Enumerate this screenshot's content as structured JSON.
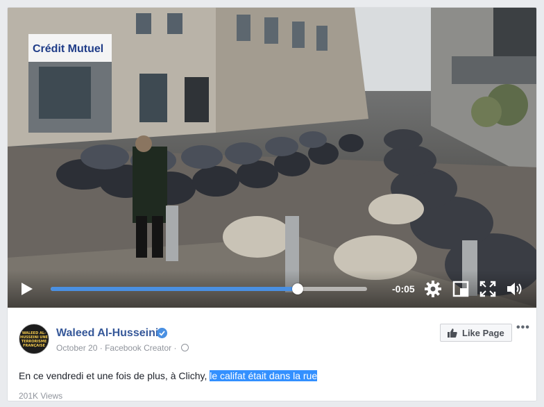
{
  "video": {
    "storefront_sign": "Crédit Mutuel",
    "progress_fraction": 0.78,
    "time_remaining": "-0:05",
    "icons": [
      "play-icon",
      "settings-gear-icon",
      "pip-icon",
      "fullscreen-icon",
      "volume-icon"
    ]
  },
  "post": {
    "page_name": "Waleed Al-Husseini",
    "verified_icon": "verified-badge-icon",
    "date": "October 20",
    "separator": "·",
    "creator_label": "Facebook Creator",
    "privacy_icon": "globe-icon",
    "like_button_label": "Like Page",
    "text_plain": "En ce vendredi et une fois de plus, à Clichy, ",
    "text_highlighted": "le califat était dans la rue",
    "views": "201K Views",
    "avatar_caption": "WALEED AL-HUSSEINI UNE TERRORISME FRANÇAISE"
  },
  "colors": {
    "link": "#365899",
    "progress": "#4a90e2",
    "highlight": "#3390ff",
    "muted": "#90949c"
  }
}
